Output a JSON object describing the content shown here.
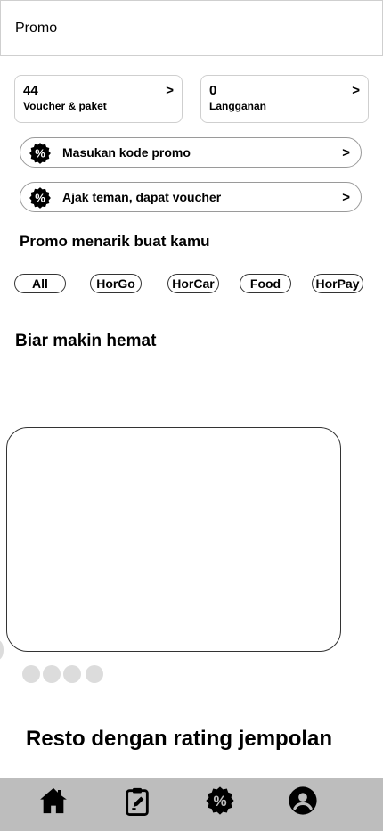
{
  "header": {
    "title": "Promo"
  },
  "cards": [
    {
      "count": "44",
      "label": "Voucher & paket",
      "arrow": ">"
    },
    {
      "count": "0",
      "label": "Langganan",
      "arrow": ">"
    }
  ],
  "rows": [
    {
      "label": "Masukan kode promo",
      "arrow": ">",
      "icon": "discount-badge-icon"
    },
    {
      "label": "Ajak teman, dapat voucher",
      "arrow": ">",
      "icon": "discount-badge-icon"
    }
  ],
  "sections": {
    "promo_title": "Promo menarik buat kamu",
    "hemat_title": "Biar makin hemat",
    "resto_title": "Resto dengan rating jempolan"
  },
  "filters": [
    "All",
    "HorGo",
    "HorCar",
    "Food",
    "HorPay"
  ],
  "carousel": {
    "total_slides": 4
  },
  "bottom_nav": [
    {
      "name": "home",
      "icon": "home-icon"
    },
    {
      "name": "orders",
      "icon": "clipboard-icon"
    },
    {
      "name": "promo",
      "icon": "discount-badge-icon"
    },
    {
      "name": "account",
      "icon": "user-circle-icon"
    }
  ],
  "colors": {
    "nav_background": "#bdbdbd",
    "dot": "#dcdcdc",
    "border": "#cfcfcf"
  }
}
